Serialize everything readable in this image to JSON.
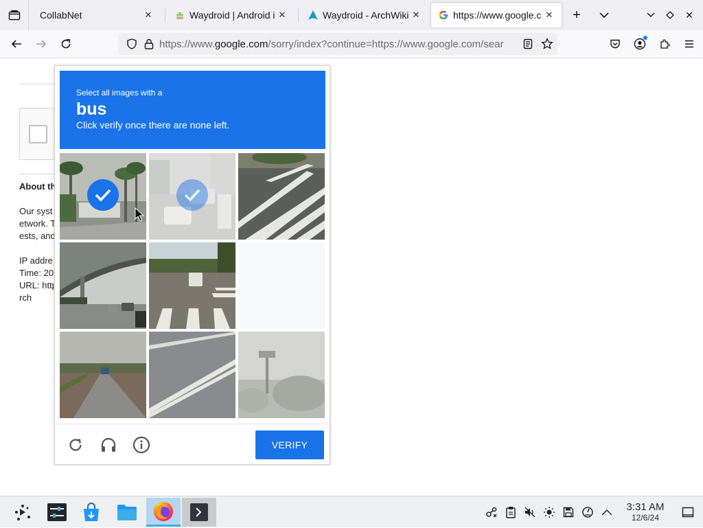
{
  "tabs": [
    {
      "title": "CollabNet",
      "favicon": "none"
    },
    {
      "title": "Waydroid | Android i",
      "favicon": "waydroid-icon"
    },
    {
      "title": "Waydroid - ArchWiki",
      "favicon": "arch-icon"
    },
    {
      "title": "https://www.google.c",
      "favicon": "google-icon",
      "active": true
    }
  ],
  "url": {
    "prefix": "https://www.",
    "host": "google.com",
    "rest": "/sorry/index?continue=https://www.google.com/sear"
  },
  "background_page": {
    "about_heading": "About th",
    "lines": [
      "Our syst",
      "etwork. T",
      "ests, and"
    ],
    "meta_lines": [
      "IP addre",
      "Time: 20",
      "URL: http",
      "rch"
    ]
  },
  "captcha": {
    "instruction_small": "Select all images with a",
    "target": "bus",
    "instruction_sub": "Click verify once there are none left.",
    "verify_label": "VERIFY",
    "accent_color": "#1a73e8",
    "tiles": [
      {
        "state": "selected",
        "scene": "palm-street-bus"
      },
      {
        "state": "selected-fading",
        "scene": "road-cars"
      },
      {
        "state": "normal",
        "scene": "crosswalk"
      },
      {
        "state": "normal",
        "scene": "overpass-traffic"
      },
      {
        "state": "normal",
        "scene": "street-crosswalk"
      },
      {
        "state": "empty",
        "scene": "loading"
      },
      {
        "state": "normal",
        "scene": "rural-road"
      },
      {
        "state": "normal",
        "scene": "road-lines"
      },
      {
        "state": "normal",
        "scene": "faded-street"
      }
    ]
  },
  "taskbar": {
    "time": "3:31 AM",
    "date": "12/6/24"
  }
}
